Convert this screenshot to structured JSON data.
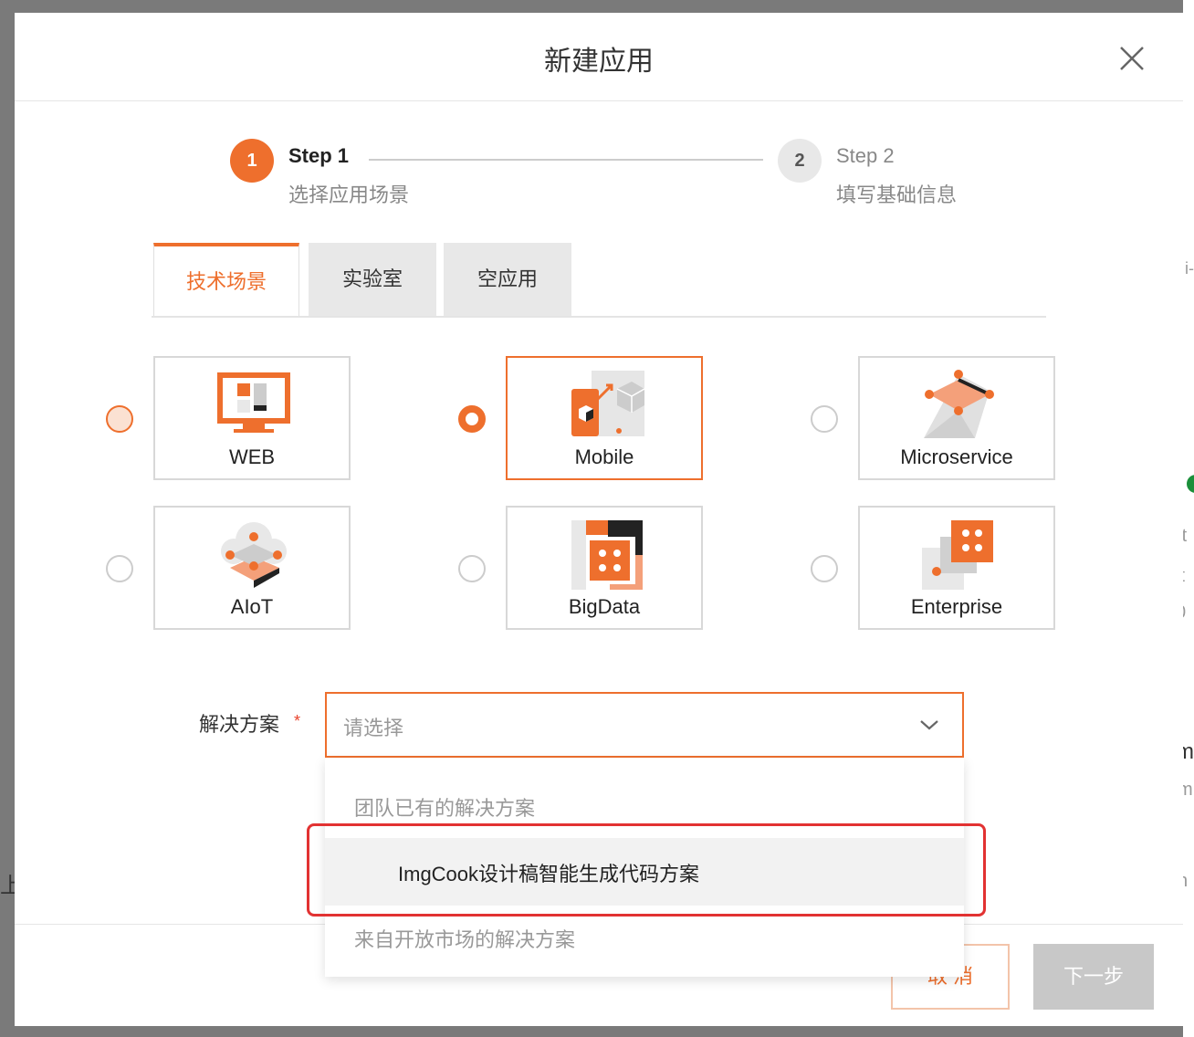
{
  "background": {
    "right_fragments": [
      "i",
      "i-",
      "rt",
      "it",
      "0",
      "m",
      "m",
      "n"
    ],
    "left_fragment": "上"
  },
  "modal": {
    "title": "新建应用",
    "close_icon": "close-icon"
  },
  "steps": [
    {
      "number": "1",
      "title": "Step 1",
      "desc": "选择应用场景",
      "state": "active"
    },
    {
      "number": "2",
      "title": "Step 2",
      "desc": "填写基础信息",
      "state": "pending"
    }
  ],
  "tabs": [
    {
      "label": "技术场景",
      "active": true
    },
    {
      "label": "实验室",
      "active": false
    },
    {
      "label": "空应用",
      "active": false
    }
  ],
  "scenarios": [
    {
      "label": "WEB",
      "icon": "web-monitor-icon",
      "radio": "hover"
    },
    {
      "label": "Mobile",
      "icon": "mobile-cube-icon",
      "radio": "checked"
    },
    {
      "label": "Microservice",
      "icon": "microservice-pyramid-icon",
      "radio": "unchecked"
    },
    {
      "label": "AIoT",
      "icon": "aiot-cloud-icon",
      "radio": "unchecked"
    },
    {
      "label": "BigData",
      "icon": "bigdata-dice-icon",
      "radio": "unchecked"
    },
    {
      "label": "Enterprise",
      "icon": "enterprise-blocks-icon",
      "radio": "unchecked"
    }
  ],
  "form": {
    "solution_label": "解决方案",
    "required_mark": "*",
    "solution_placeholder": "请选择"
  },
  "dropdown": {
    "group_team": "团队已有的解决方案",
    "option_imgcook": "ImgCook设计稿智能生成代码方案",
    "group_market": "来自开放市场的解决方案"
  },
  "footer": {
    "cancel_label": "取 消",
    "next_label": "下一步"
  },
  "colors": {
    "accent": "#ee6f2d",
    "highlight_box": "#e23232"
  }
}
